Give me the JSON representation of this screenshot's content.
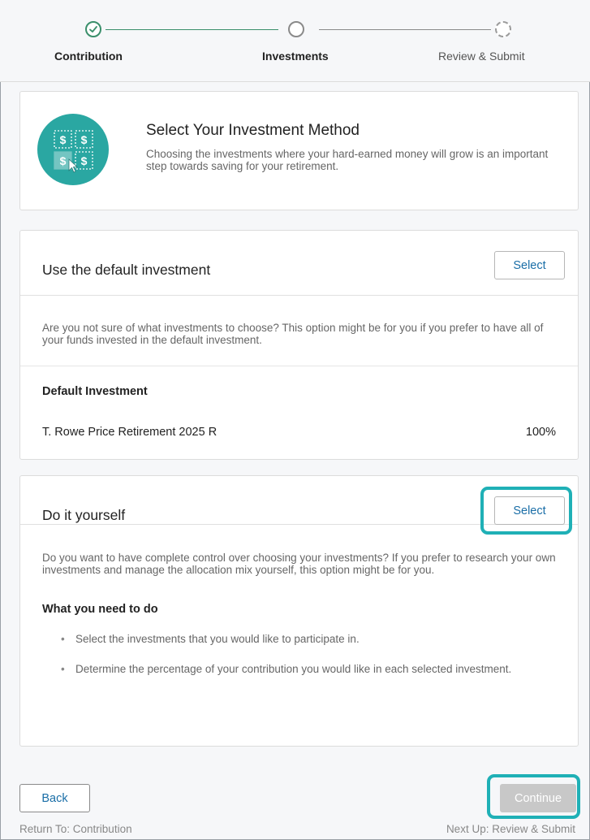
{
  "stepper": {
    "steps": [
      {
        "label": "Contribution",
        "status": "complete"
      },
      {
        "label": "Investments",
        "status": "current"
      },
      {
        "label": "Review & Submit",
        "status": "upcoming"
      }
    ]
  },
  "intro": {
    "icon": "investment-dollar-grid-icon",
    "title": "Select Your Investment Method",
    "description": "Choosing the investments where your hard-earned money will grow is an important step towards saving for your retirement."
  },
  "default_option": {
    "title": "Use the default investment",
    "select_label": "Select",
    "description": "Are you not sure of what investments to choose? This option might be for you if you prefer to have all of your funds invested in the default investment.",
    "subheading": "Default Investment",
    "fund_name": "T. Rowe Price Retirement 2025 R",
    "fund_percent": "100%"
  },
  "diy_option": {
    "title": "Do it yourself",
    "select_label": "Select",
    "description": "Do you want to have complete control over choosing your investments? If you prefer to research your own investments and manage the allocation mix yourself, this option might be for you.",
    "subheading": "What you need to do",
    "bullets": [
      "Select the investments that you would like to participate in.",
      "Determine the percentage of your contribution you would like in each selected investment."
    ]
  },
  "footer": {
    "back_label": "Back",
    "return_text": "Return To: Contribution",
    "continue_label": "Continue",
    "next_text": "Next Up: Review & Submit"
  },
  "colors": {
    "accent": "#2aa7a2",
    "highlight": "#1fb0b6",
    "complete": "#3a8f6b",
    "link": "#1a6ea7"
  }
}
